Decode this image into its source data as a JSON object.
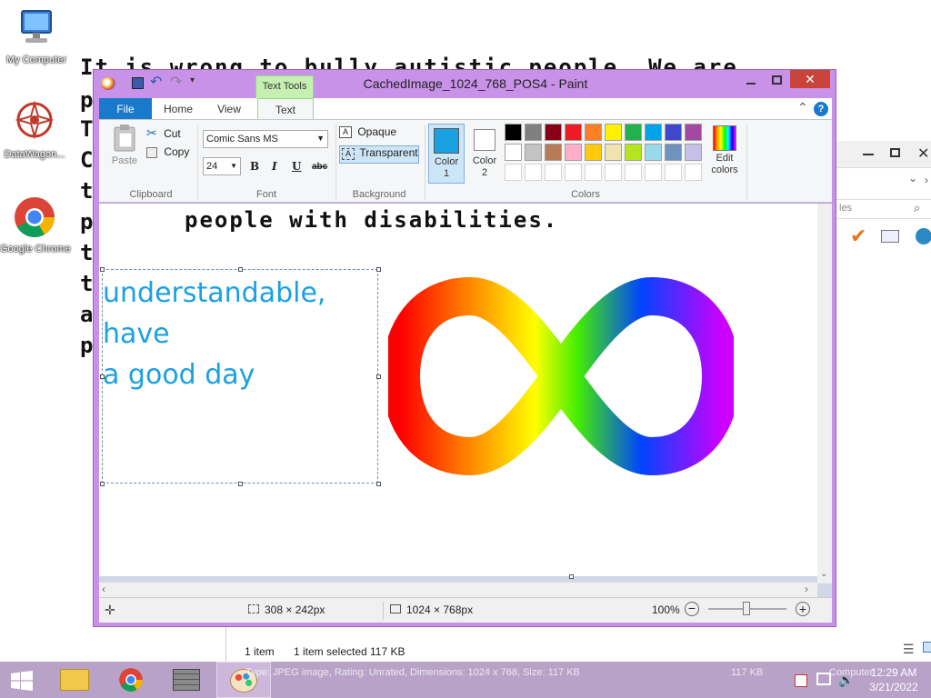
{
  "desktop": {
    "icons": [
      {
        "label": "My Computer"
      },
      {
        "label": "DataWagon..."
      },
      {
        "label": "Google Chrome"
      }
    ],
    "background_text": [
      "It is wrong to bully autistic people. We are",
      "p",
      "T",
      "C",
      "t",
      "p",
      "t",
      "t",
      "a",
      "p"
    ]
  },
  "paint": {
    "title": "CachedImage_1024_768_POS4 - Paint",
    "contextual_tab": "Text Tools",
    "tabs": [
      "File",
      "Home",
      "View",
      "Text"
    ],
    "clipboard": {
      "paste": "Paste",
      "cut": "Cut",
      "copy": "Copy",
      "group": "Clipboard"
    },
    "font": {
      "family": "Comic Sans MS",
      "size": "24",
      "group": "Font",
      "bold": "B",
      "italic": "I",
      "underline": "U",
      "strike": "abc"
    },
    "background": {
      "opaque": "Opaque",
      "transparent": "Transparent",
      "group": "Background"
    },
    "colors": {
      "color1_label": "Color\n1",
      "color2_label": "Color\n2",
      "color1": "#1ba1e2",
      "color2": "#ffffff",
      "group": "Colors",
      "edit": "Edit colors",
      "palette_row1": [
        "#000000",
        "#7f7f7f",
        "#880015",
        "#ed1c24",
        "#ff7f27",
        "#fff200",
        "#22b14c",
        "#00a2e8",
        "#3f48cc",
        "#a349a4"
      ],
      "palette_row2": [
        "#ffffff",
        "#c3c3c3",
        "#b97a57",
        "#ffaec9",
        "#ffc90e",
        "#efe4b0",
        "#b5e61d",
        "#99d9ea",
        "#7092be",
        "#c8bfe7"
      ]
    },
    "canvas": {
      "heading": "people with disabilities.",
      "textbox_lines": [
        "understandable,",
        "have",
        "a good day"
      ],
      "text_color": "#1ba1e2"
    },
    "status": {
      "selection_size": "308 × 242px",
      "image_size": "1024 × 768px",
      "zoom": "100%"
    }
  },
  "explorer": {
    "search_placeholder": "les",
    "items_count": "1 item",
    "selected": "1 item selected",
    "selected_size": "117 KB",
    "details": "Type: JPEG image, Rating: Unrated, Dimensions: 1024 x 768, Size: 117 KB",
    "size_col": "117 KB",
    "computer": "Computer"
  },
  "taskbar": {
    "time": "12:29 AM",
    "date": "3/21/2022"
  }
}
